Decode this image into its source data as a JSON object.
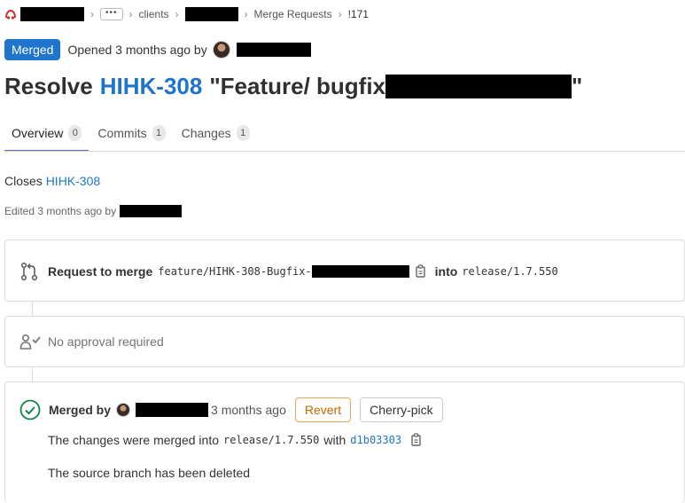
{
  "breadcrumb": {
    "more": "•••",
    "group": "clients",
    "section": "Merge Requests",
    "mr_id": "!171"
  },
  "status": {
    "badge": "Merged",
    "opened": "Opened 3 months ago by"
  },
  "title": {
    "prefix": "Resolve",
    "issue": "HIHK-308",
    "text": "\"Feature/ bugfix",
    "suffix": "\""
  },
  "tabs": [
    {
      "label": "Overview",
      "count": "0"
    },
    {
      "label": "Commits",
      "count": "1"
    },
    {
      "label": "Changes",
      "count": "1"
    }
  ],
  "description": {
    "closes": "Closes",
    "closes_issue": "HIHK-308",
    "edited": "Edited 3 months ago by"
  },
  "merge_request": {
    "label": "Request to merge",
    "source_branch": "feature/HIHK-308-Bugfix-",
    "into": "into",
    "target_branch": "release/1.7.550"
  },
  "approval": {
    "text": "No approval required"
  },
  "merged": {
    "by_label": "Merged by",
    "time": "3 months ago",
    "revert": "Revert",
    "cherry_pick": "Cherry-pick",
    "changes_text": "The changes were merged into",
    "target_branch": "release/1.7.550",
    "with": "with",
    "sha": "d1b03303",
    "deleted_text": "The source branch has been deleted"
  },
  "colors": {
    "accent": "#1f75cb",
    "success": "#108548",
    "tab_underline": "#6666c4",
    "revert": "#c16800"
  }
}
